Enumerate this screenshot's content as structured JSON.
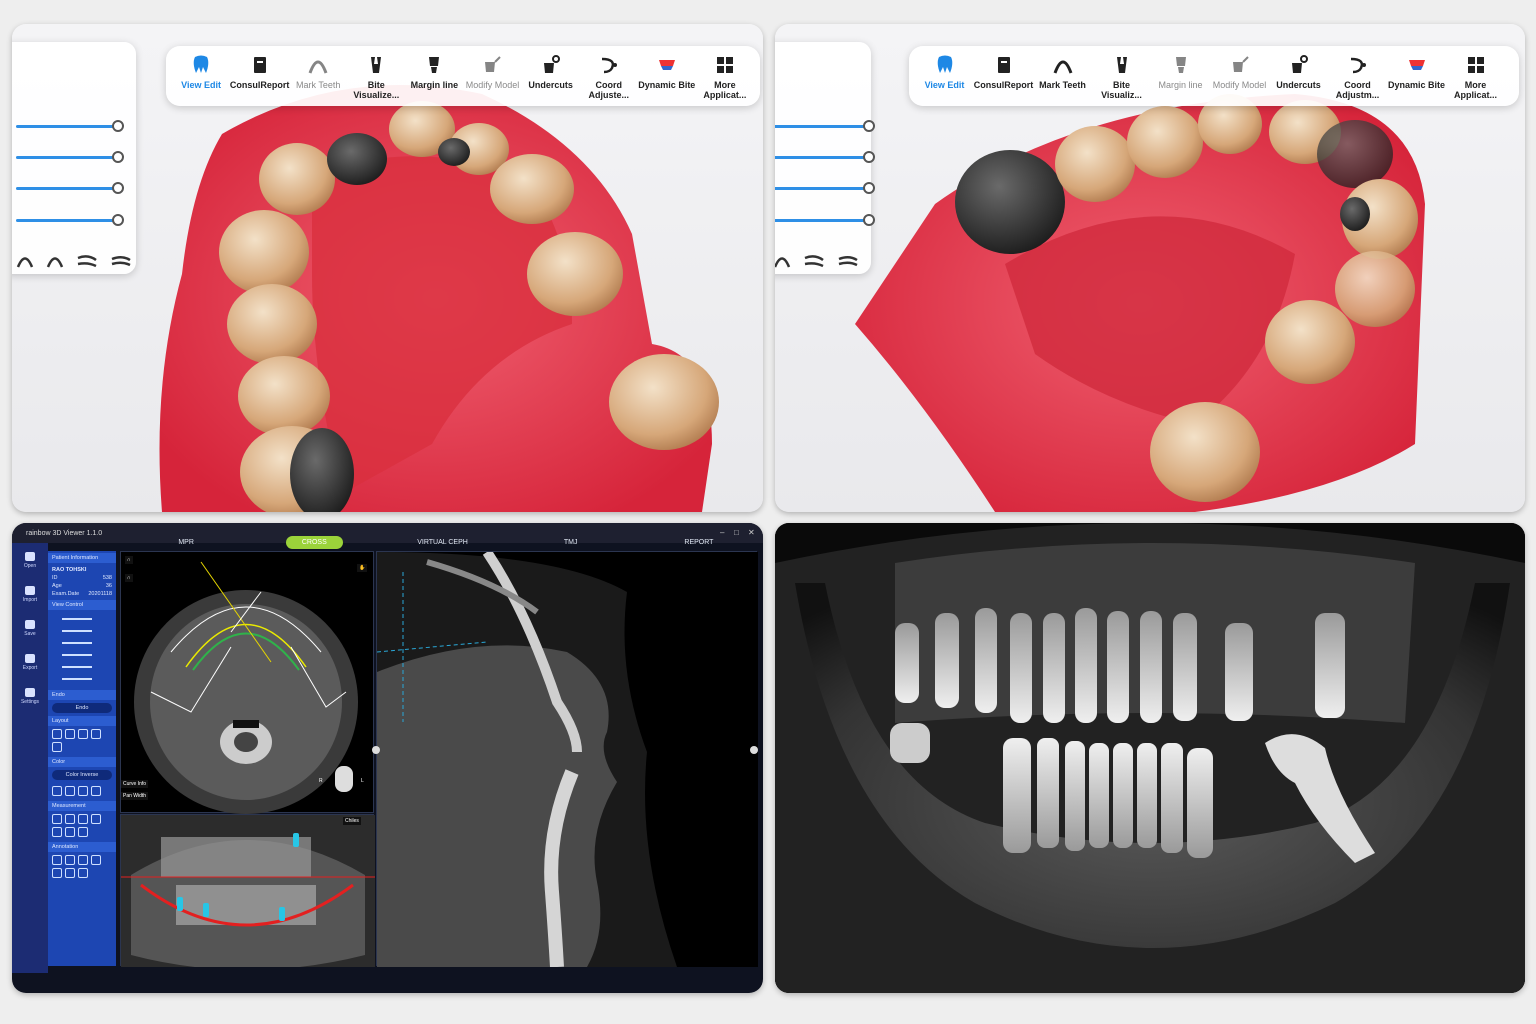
{
  "toolbar_left": {
    "items": [
      {
        "label": "View Edit",
        "icon": "tooth-icon",
        "state": "active"
      },
      {
        "label": "ConsulReport",
        "icon": "report-icon",
        "state": "normal"
      },
      {
        "label": "Mark Teeth",
        "icon": "mark-teeth-icon",
        "state": "dim"
      },
      {
        "label": "Bite\nVisualize...",
        "icon": "bite-icon",
        "state": "normal"
      },
      {
        "label": "Margin line",
        "icon": "margin-line-icon",
        "state": "normal"
      },
      {
        "label": "Modify Model",
        "icon": "modify-model-icon",
        "state": "dim"
      },
      {
        "label": "Undercuts",
        "icon": "undercuts-icon",
        "state": "normal"
      },
      {
        "label": "Coord\nAdjuste...",
        "icon": "coord-icon",
        "state": "normal"
      },
      {
        "label": "Dynamic Bite",
        "icon": "dynamic-bite-icon",
        "state": "normal"
      },
      {
        "label": "More\nApplicat...",
        "icon": "more-apps-icon",
        "state": "normal"
      }
    ]
  },
  "toolbar_right": {
    "items": [
      {
        "label": "View Edit",
        "icon": "tooth-icon",
        "state": "active"
      },
      {
        "label": "ConsulReport",
        "icon": "report-icon",
        "state": "normal"
      },
      {
        "label": "Mark Teeth",
        "icon": "mark-teeth-icon",
        "state": "normal"
      },
      {
        "label": "Bite\nVisualiz...",
        "icon": "bite-icon",
        "state": "normal"
      },
      {
        "label": "Margin line",
        "icon": "margin-line-icon",
        "state": "dim"
      },
      {
        "label": "Modify Model",
        "icon": "modify-model-icon",
        "state": "dim"
      },
      {
        "label": "Undercuts",
        "icon": "undercuts-icon",
        "state": "normal"
      },
      {
        "label": "Coord\nAdjustm...",
        "icon": "coord-icon",
        "state": "normal"
      },
      {
        "label": "Dynamic Bite",
        "icon": "dynamic-bite-icon",
        "state": "normal"
      },
      {
        "label": "More\nApplicat...",
        "icon": "more-apps-icon",
        "state": "normal"
      }
    ]
  },
  "colors": {
    "accent": "#1e88e5",
    "gum": "#e8384a",
    "viewer_sidebar": "#1d46b2",
    "cross_tab": "#9bd33a",
    "implant": "#27c6e6"
  },
  "viewer": {
    "title": "rainbow 3D Viewer 1.1.0",
    "tabs": [
      {
        "label": "MPR",
        "active": false
      },
      {
        "label": "CROSS",
        "active": true
      },
      {
        "label": "VIRTUAL CEPH",
        "active": false
      },
      {
        "label": "TMJ",
        "active": false
      },
      {
        "label": "REPORT",
        "active": false
      }
    ],
    "nav": [
      "Open",
      "Import",
      "Save",
      "Export",
      "Settings"
    ],
    "patient_section": "Patient Information",
    "patient_name": "RAO TOHSKI",
    "patient_rows": [
      {
        "k": "ID",
        "v": "538"
      },
      {
        "k": "Age",
        "v": "36"
      },
      {
        "k": "Exam.Date",
        "v": "20201118"
      }
    ],
    "view_control": "View Control",
    "endo_section": "Endo",
    "endo_button": "Endo",
    "layout_section": "Layout",
    "color_section": "Color",
    "color_button": "Color Inverse",
    "measurement_section": "Measurement",
    "annotation_section": "Annotation",
    "curve_info": "Curve Info",
    "pan_width": "Pan Width",
    "chiles": "Chiles",
    "marker_r": "R",
    "marker_l": "L"
  }
}
